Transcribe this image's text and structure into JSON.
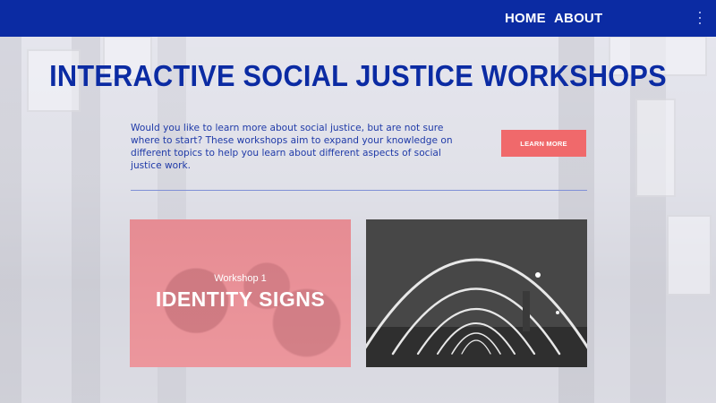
{
  "nav": {
    "home": "HOME",
    "about": "ABOUT",
    "menu_icon": "vertical-dots-icon"
  },
  "hero": {
    "title": "INTERACTIVE SOCIAL JUSTICE WORKSHOPS",
    "intro": "Would you like to learn more about social justice, but are not sure where to start? These workshops aim to expand your knowledge on different topics to help you learn about different aspects of social justice work.",
    "cta_label": "LEARN MORE"
  },
  "workshops": [
    {
      "kicker": "Workshop 1",
      "title": "IDENTITY SIGNS"
    },
    {
      "kicker": "",
      "title": ""
    }
  ],
  "colors": {
    "brand_blue": "#0b2ba3",
    "accent_coral": "#f0696b",
    "card_tint": "#f08c94"
  }
}
